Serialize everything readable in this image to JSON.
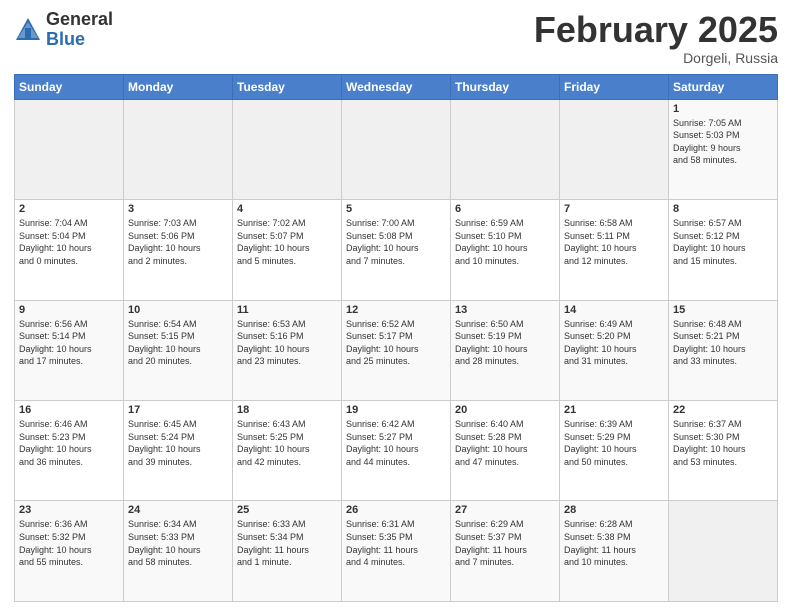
{
  "header": {
    "logo_general": "General",
    "logo_blue": "Blue",
    "month_year": "February 2025",
    "location": "Dorgeli, Russia"
  },
  "weekdays": [
    "Sunday",
    "Monday",
    "Tuesday",
    "Wednesday",
    "Thursday",
    "Friday",
    "Saturday"
  ],
  "weeks": [
    [
      {
        "day": "",
        "info": ""
      },
      {
        "day": "",
        "info": ""
      },
      {
        "day": "",
        "info": ""
      },
      {
        "day": "",
        "info": ""
      },
      {
        "day": "",
        "info": ""
      },
      {
        "day": "",
        "info": ""
      },
      {
        "day": "1",
        "info": "Sunrise: 7:05 AM\nSunset: 5:03 PM\nDaylight: 9 hours\nand 58 minutes."
      }
    ],
    [
      {
        "day": "2",
        "info": "Sunrise: 7:04 AM\nSunset: 5:04 PM\nDaylight: 10 hours\nand 0 minutes."
      },
      {
        "day": "3",
        "info": "Sunrise: 7:03 AM\nSunset: 5:06 PM\nDaylight: 10 hours\nand 2 minutes."
      },
      {
        "day": "4",
        "info": "Sunrise: 7:02 AM\nSunset: 5:07 PM\nDaylight: 10 hours\nand 5 minutes."
      },
      {
        "day": "5",
        "info": "Sunrise: 7:00 AM\nSunset: 5:08 PM\nDaylight: 10 hours\nand 7 minutes."
      },
      {
        "day": "6",
        "info": "Sunrise: 6:59 AM\nSunset: 5:10 PM\nDaylight: 10 hours\nand 10 minutes."
      },
      {
        "day": "7",
        "info": "Sunrise: 6:58 AM\nSunset: 5:11 PM\nDaylight: 10 hours\nand 12 minutes."
      },
      {
        "day": "8",
        "info": "Sunrise: 6:57 AM\nSunset: 5:12 PM\nDaylight: 10 hours\nand 15 minutes."
      }
    ],
    [
      {
        "day": "9",
        "info": "Sunrise: 6:56 AM\nSunset: 5:14 PM\nDaylight: 10 hours\nand 17 minutes."
      },
      {
        "day": "10",
        "info": "Sunrise: 6:54 AM\nSunset: 5:15 PM\nDaylight: 10 hours\nand 20 minutes."
      },
      {
        "day": "11",
        "info": "Sunrise: 6:53 AM\nSunset: 5:16 PM\nDaylight: 10 hours\nand 23 minutes."
      },
      {
        "day": "12",
        "info": "Sunrise: 6:52 AM\nSunset: 5:17 PM\nDaylight: 10 hours\nand 25 minutes."
      },
      {
        "day": "13",
        "info": "Sunrise: 6:50 AM\nSunset: 5:19 PM\nDaylight: 10 hours\nand 28 minutes."
      },
      {
        "day": "14",
        "info": "Sunrise: 6:49 AM\nSunset: 5:20 PM\nDaylight: 10 hours\nand 31 minutes."
      },
      {
        "day": "15",
        "info": "Sunrise: 6:48 AM\nSunset: 5:21 PM\nDaylight: 10 hours\nand 33 minutes."
      }
    ],
    [
      {
        "day": "16",
        "info": "Sunrise: 6:46 AM\nSunset: 5:23 PM\nDaylight: 10 hours\nand 36 minutes."
      },
      {
        "day": "17",
        "info": "Sunrise: 6:45 AM\nSunset: 5:24 PM\nDaylight: 10 hours\nand 39 minutes."
      },
      {
        "day": "18",
        "info": "Sunrise: 6:43 AM\nSunset: 5:25 PM\nDaylight: 10 hours\nand 42 minutes."
      },
      {
        "day": "19",
        "info": "Sunrise: 6:42 AM\nSunset: 5:27 PM\nDaylight: 10 hours\nand 44 minutes."
      },
      {
        "day": "20",
        "info": "Sunrise: 6:40 AM\nSunset: 5:28 PM\nDaylight: 10 hours\nand 47 minutes."
      },
      {
        "day": "21",
        "info": "Sunrise: 6:39 AM\nSunset: 5:29 PM\nDaylight: 10 hours\nand 50 minutes."
      },
      {
        "day": "22",
        "info": "Sunrise: 6:37 AM\nSunset: 5:30 PM\nDaylight: 10 hours\nand 53 minutes."
      }
    ],
    [
      {
        "day": "23",
        "info": "Sunrise: 6:36 AM\nSunset: 5:32 PM\nDaylight: 10 hours\nand 55 minutes."
      },
      {
        "day": "24",
        "info": "Sunrise: 6:34 AM\nSunset: 5:33 PM\nDaylight: 10 hours\nand 58 minutes."
      },
      {
        "day": "25",
        "info": "Sunrise: 6:33 AM\nSunset: 5:34 PM\nDaylight: 11 hours\nand 1 minute."
      },
      {
        "day": "26",
        "info": "Sunrise: 6:31 AM\nSunset: 5:35 PM\nDaylight: 11 hours\nand 4 minutes."
      },
      {
        "day": "27",
        "info": "Sunrise: 6:29 AM\nSunset: 5:37 PM\nDaylight: 11 hours\nand 7 minutes."
      },
      {
        "day": "28",
        "info": "Sunrise: 6:28 AM\nSunset: 5:38 PM\nDaylight: 11 hours\nand 10 minutes."
      },
      {
        "day": "",
        "info": ""
      }
    ]
  ]
}
